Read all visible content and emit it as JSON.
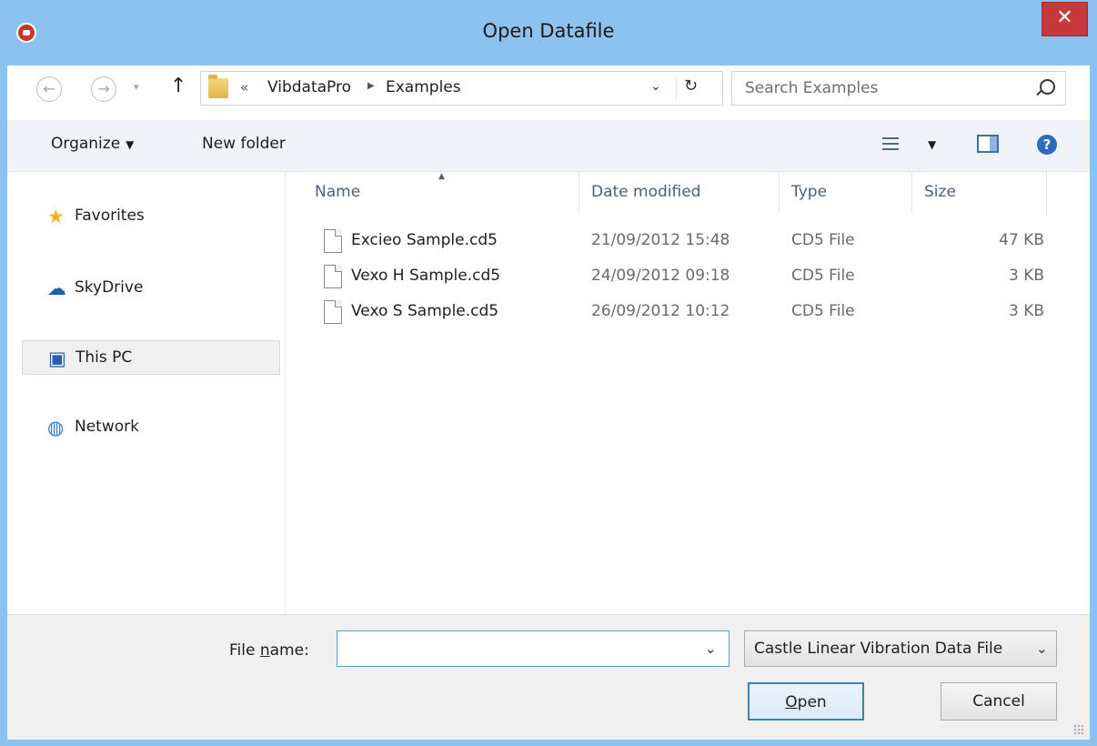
{
  "window": {
    "title": "Open Datafile",
    "close_symbol": "✕"
  },
  "nav": {
    "back_symbol": "←",
    "forward_symbol": "→",
    "recent_symbol": "▾",
    "up_symbol": "↑",
    "breadcrumb_prefix": "«",
    "breadcrumbs": [
      "VibdataPro",
      "Examples"
    ],
    "breadcrumb_sep": "▶",
    "dropdown_symbol": "⌄",
    "refresh_symbol": "↻",
    "search_placeholder": "Search Examples"
  },
  "toolbar": {
    "organize_label": "Organize",
    "organize_caret": "▼",
    "new_folder_label": "New folder",
    "view_caret": "▼",
    "help_symbol": "?"
  },
  "sidebar": {
    "items": [
      {
        "label": "Favorites",
        "icon": "★"
      },
      {
        "label": "SkyDrive",
        "icon": "☁"
      },
      {
        "label": "This PC",
        "icon": "▣"
      },
      {
        "label": "Network",
        "icon": "◍"
      }
    ]
  },
  "filelist": {
    "columns": [
      "Name",
      "Date modified",
      "Type",
      "Size"
    ],
    "sort_symbol": "▲",
    "rows": [
      {
        "name": "Excieo Sample.cd5",
        "date": "21/09/2012 15:48",
        "type": "CD5 File",
        "size": "47 KB"
      },
      {
        "name": "Vexo H Sample.cd5",
        "date": "24/09/2012 09:18",
        "type": "CD5 File",
        "size": "3 KB"
      },
      {
        "name": "Vexo S Sample.cd5",
        "date": "26/09/2012 10:12",
        "type": "CD5 File",
        "size": "3 KB"
      }
    ]
  },
  "footer": {
    "filename_label_pre": "File ",
    "filename_label_accel": "n",
    "filename_label_post": "ame:",
    "filename_value": "",
    "filename_drop_symbol": "⌄",
    "filetype_value": "Castle Linear Vibration Data File",
    "filetype_drop_symbol": "⌄",
    "open_label_accel": "O",
    "open_label_rest": "pen",
    "cancel_label": "Cancel"
  },
  "colors": {
    "titlebar": "#8cc2ef",
    "close": "#c7383a",
    "accent": "#3c7fb1"
  }
}
